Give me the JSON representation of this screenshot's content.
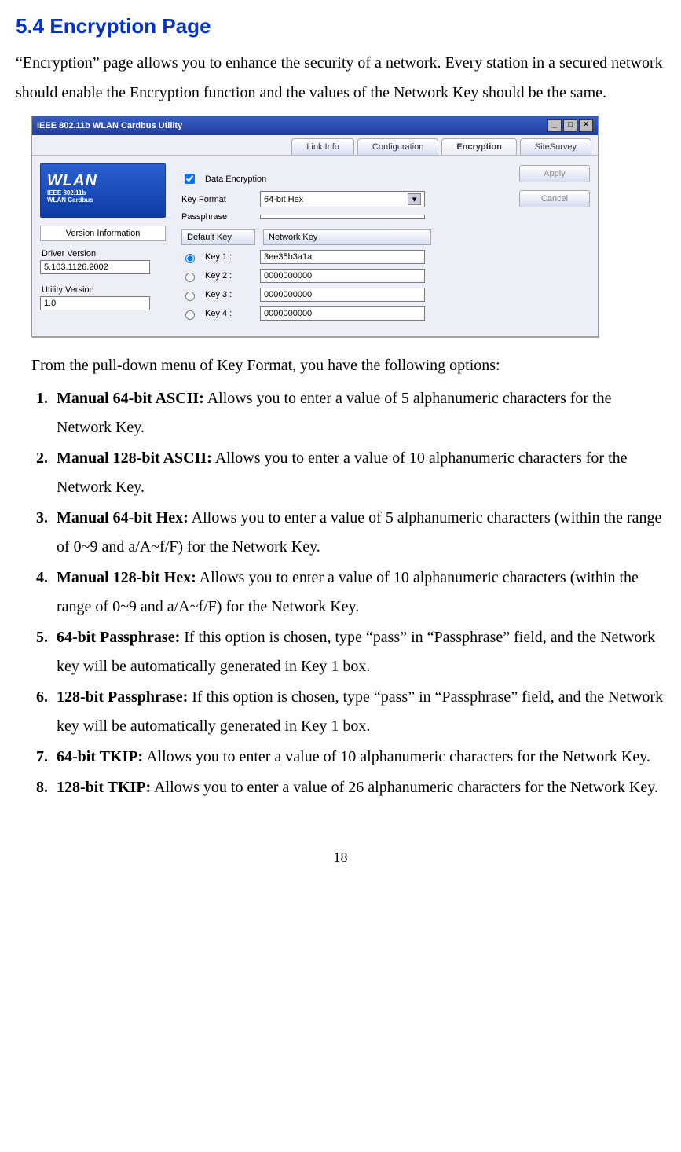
{
  "heading": "5.4 Encryption Page",
  "intro": "“Encryption” page allows you to enhance the security of a network. Every station in a secured network should enable the Encryption function and the values of the Network Key should be the same.",
  "win": {
    "title": "IEEE 802.11b WLAN Cardbus Utility",
    "tabs": [
      "Link Info",
      "Configuration",
      "Encryption",
      "SiteSurvey"
    ],
    "active_tab": "Encryption",
    "logo_big": "WLAN",
    "logo_small1": "IEEE 802.11b",
    "logo_small2": "WLAN Cardbus",
    "version_info_label": "Version Information",
    "driver_label": "Driver Version",
    "driver_value": "5.103.1126.2002",
    "utility_label": "Utility Version",
    "utility_value": "1.0",
    "data_encryption_label": "Data Encryption",
    "data_encryption_checked": true,
    "key_format_label": "Key Format",
    "key_format_value": "64-bit Hex",
    "passphrase_label": "Passphrase",
    "passphrase_value": "",
    "default_key_header": "Default Key",
    "network_key_header": "Network Key",
    "keys": [
      {
        "label": "Key 1 :",
        "value": "3ee35b3a1a",
        "selected": true
      },
      {
        "label": "Key 2 :",
        "value": "0000000000",
        "selected": false
      },
      {
        "label": "Key 3 :",
        "value": "0000000000",
        "selected": false
      },
      {
        "label": "Key 4 :",
        "value": "0000000000",
        "selected": false
      }
    ],
    "apply_label": "Apply",
    "cancel_label": "Cancel"
  },
  "lead": "From the pull-down menu of Key Format, you have the following options:",
  "options": [
    {
      "title": "Manual 64-bit ASCII:",
      "desc": " Allows you to enter a value of 5 alphanumeric characters for the Network Key."
    },
    {
      "title": "Manual 128-bit ASCII:",
      "desc": " Allows you to enter a value of 10 alphanumeric characters for the Network Key."
    },
    {
      "title": "Manual 64-bit Hex:",
      "desc": " Allows you to enter a value of 5 alphanumeric characters (within the range of 0~9 and a/A~f/F) for the Network Key."
    },
    {
      "title": "Manual 128-bit Hex:",
      "desc": " Allows you to enter a value of 10 alphanumeric characters (within the range of 0~9 and a/A~f/F) for the Network Key."
    },
    {
      "title": "64-bit Passphrase:",
      "desc": " If this option is chosen, type “pass” in “Passphrase” field, and the Network key will be automatically generated in Key 1 box."
    },
    {
      "title": "128-bit Passphrase:",
      "desc": " If this option is chosen, type “pass” in “Passphrase” field, and the Network key will be automatically generated in Key 1 box."
    },
    {
      "title": "64-bit TKIP:",
      "desc": " Allows you to enter a value of 10 alphanumeric characters for the Network Key."
    },
    {
      "title": "128-bit TKIP:",
      "desc": " Allows you to enter a value of 26 alphanumeric characters for the Network Key."
    }
  ],
  "page_number": "18"
}
